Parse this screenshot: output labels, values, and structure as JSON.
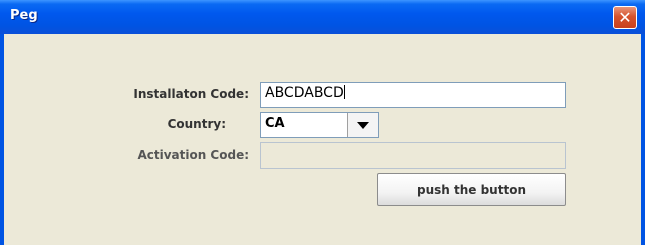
{
  "window": {
    "title": "Peg"
  },
  "form": {
    "installation_label": "Installaton Code:",
    "installation_value": "ABCDABCD",
    "country_label": "Country:",
    "country_value": "CA",
    "activation_label": "Activation Code:",
    "activation_value": ""
  },
  "actions": {
    "push_label": "push the button"
  },
  "icons": {
    "close": "close-icon",
    "dropdown": "chevron-down-icon"
  },
  "colors": {
    "titlebar": "#0054e3",
    "close": "#d5532d",
    "client": "#ece9d8"
  }
}
